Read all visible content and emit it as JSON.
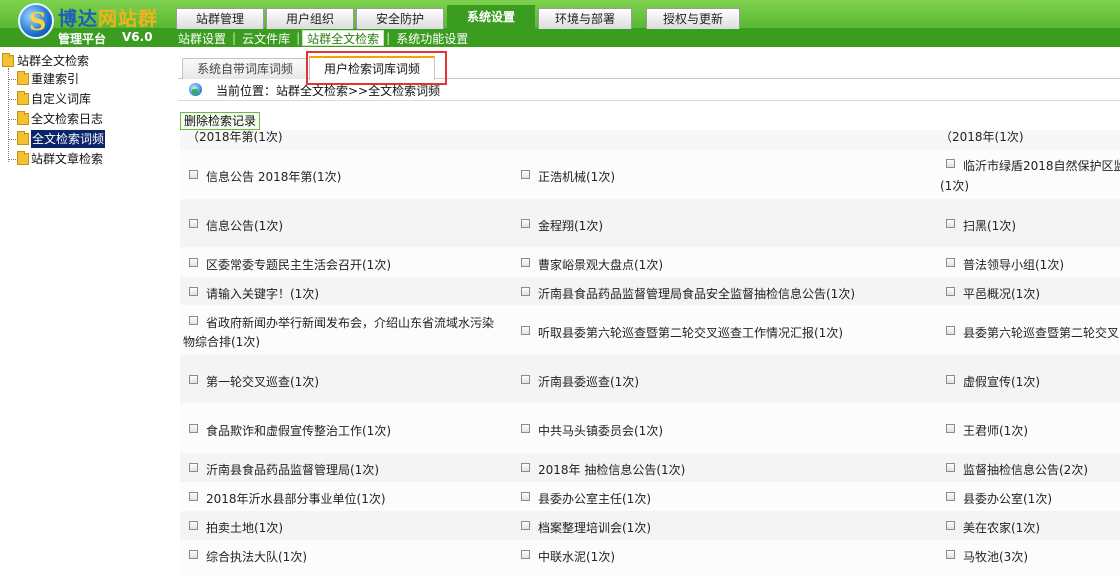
{
  "header": {
    "brand_part1": "博达",
    "brand_part2": "网站群",
    "platform": "管理平台",
    "version": "V6.0",
    "top_tabs": [
      "站群管理",
      "用户组织",
      "安全防护",
      "系统设置",
      "环境与部署",
      "授权与更新"
    ],
    "active_top_tab": "系统设置",
    "sub_nav": [
      "站群设置",
      "云文件库",
      "站群全文检索",
      "系统功能设置"
    ],
    "active_sub_nav": "站群全文检索"
  },
  "tree": {
    "root": "站群全文检索",
    "items": [
      "重建索引",
      "自定义词库",
      "全文检索日志",
      "全文检索词频",
      "站群文章检索"
    ],
    "selected": "全文检索词频"
  },
  "content_tabs": [
    "系统自带词库词频",
    "用户检索词库词频"
  ],
  "active_content_tab": "用户检索词库词频",
  "location": "当前位置：站群全文检索>>全文检索词频",
  "delete_button": "删除检索记录",
  "partial_top_left": "（2018年第(1次)",
  "partial_top_right": "（2018年(1次)",
  "rows": [
    [
      "信息公告 2018年第(1次)",
      "正浩机械(1次)",
      "临沂市绿盾2018自然保护区监",
      "(1次)"
    ],
    [
      "信息公告(1次)",
      "金程翔(1次)",
      "扫黑(1次)"
    ],
    [
      "区委常委专题民主生活会召开(1次)",
      "曹家峪景观大盘点(1次)",
      "普法领导小组(1次)"
    ],
    [
      "请输入关键字！(1次)",
      "沂南县食品药品监督管理局食品安全监督抽检信息公告(1次)",
      "平邑概况(1次)"
    ],
    [
      "省政府新闻办举行新闻发布会，介绍山东省流域水污染",
      "物综合排(1次)",
      "听取县委第六轮巡查暨第二轮交叉巡查工作情况汇报(1次)",
      "县委第六轮巡查暨第二轮交叉"
    ],
    [
      "第一轮交叉巡查(1次)",
      "沂南县委巡查(1次)",
      "虚假宣传(1次)"
    ],
    [
      "食品欺诈和虚假宣传整治工作(1次)",
      "中共马头镇委员会(1次)",
      "王君师(1次)"
    ],
    [
      "沂南县食品药品监督管理局(1次)",
      "2018年 抽检信息公告(1次)",
      "监督抽检信息公告(2次)"
    ],
    [
      "2018年沂水县部分事业单位(1次)",
      "县委办公室主任(1次)",
      "县委办公室(1次)"
    ],
    [
      "拍卖土地(1次)",
      "档案整理培训会(1次)",
      "美在农家(1次)"
    ],
    [
      "综合执法大队(1次)",
      "中联水泥(1次)",
      "马牧池(3次)"
    ]
  ]
}
